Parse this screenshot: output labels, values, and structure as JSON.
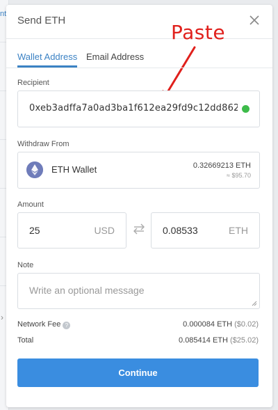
{
  "background": {
    "tab_fragment": "nt"
  },
  "modal": {
    "title": "Send ETH",
    "annotation": "Paste",
    "tabs": [
      {
        "label": "Wallet Address",
        "active": true
      },
      {
        "label": "Email Address",
        "active": false
      }
    ],
    "recipient": {
      "label": "Recipient",
      "value": "0xeb3adffa7a0ad3ba1f612ea29fd9c12dd862"
    },
    "withdraw_from": {
      "label": "Withdraw From",
      "wallet_name": "ETH Wallet",
      "balance": "0.32669213 ETH",
      "balance_usd": "≈ $95.70"
    },
    "amount": {
      "label": "Amount",
      "usd_value": "25",
      "usd_unit": "USD",
      "eth_value": "0.08533",
      "eth_unit": "ETH"
    },
    "note": {
      "label": "Note",
      "placeholder": "Write an optional message"
    },
    "network_fee": {
      "label": "Network Fee",
      "eth": "0.000084 ETH",
      "usd": "($0.02)"
    },
    "total": {
      "label": "Total",
      "eth": "0.085414 ETH",
      "usd": "($25.02)"
    },
    "continue_label": "Continue"
  },
  "colors": {
    "accent": "#3b82c4",
    "button": "#3a8de0",
    "valid": "#3dbb4a",
    "annotation": "#e0201c",
    "eth_icon": "#6f7cba"
  }
}
